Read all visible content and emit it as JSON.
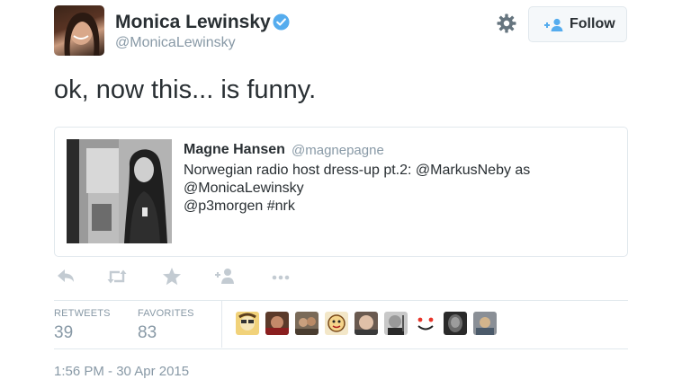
{
  "author": {
    "name": "Monica Lewinsky",
    "handle": "@MonicaLewinsky",
    "verified": true
  },
  "follow_label": "Follow",
  "tweet_text": "ok, now this... is funny.",
  "quoted": {
    "name": "Magne Hansen",
    "handle": "@magnepagne",
    "lines": [
      "Norwegian radio host dress-up pt.2: @MarkusNeby as",
      "@MonicaLewinsky",
      "@p3morgen #nrk"
    ]
  },
  "actions": [
    "reply-icon",
    "retweet-icon",
    "favorite-star-icon",
    "follow-user-icon",
    "more-dots-icon"
  ],
  "stats": {
    "retweets_label": "RETWEETS",
    "retweets": "39",
    "favorites_label": "FAVORITES",
    "favorites": "83"
  },
  "favoriters_count_shown": 9,
  "timestamp": "1:56 PM - 30 Apr 2015",
  "colors": {
    "accent": "#55acee",
    "text": "#292f33",
    "muted": "#8899a6",
    "border": "#e1e8ed"
  }
}
